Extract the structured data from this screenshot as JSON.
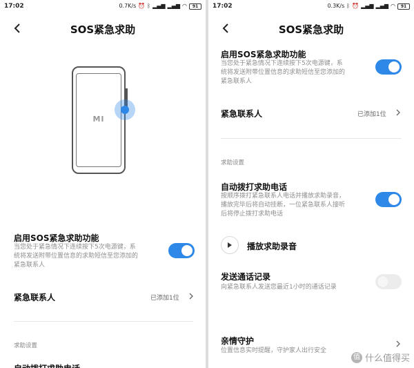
{
  "left": {
    "status": {
      "time": "17:02",
      "speed": "0.7K/s",
      "battery": "91"
    },
    "title": "SOS紧急求助",
    "illustration_logo": "MI",
    "enable": {
      "title": "启用SOS紧急求助功能",
      "desc_lines": [
        "当您处于紧急情况下连续按下5次电源键，系",
        "统将发送附带位置信息的求助短信至您添加的",
        "紧急联系人"
      ]
    },
    "contacts": {
      "title": "紧急联系人",
      "value": "已添加1位"
    },
    "section": "求助设置",
    "auto_call": {
      "title": "自动拨打求助电话"
    }
  },
  "right": {
    "status": {
      "time": "17:02",
      "speed": "0.3K/s",
      "battery": "91"
    },
    "title": "SOS紧急求助",
    "enable": {
      "title": "启用SOS紧急求助功能",
      "desc_lines": [
        "当您处于紧急情况下连续按下5次电源键，系",
        "统将发送附带位置信息的求助短信至您添加的",
        "紧急联系人"
      ]
    },
    "contacts": {
      "title": "紧急联系人",
      "value": "已添加1位"
    },
    "section": "求助设置",
    "auto_call": {
      "title": "自动拨打求助电话",
      "desc_lines": [
        "按顺序拨打紧急联系人电话并播放求助录音，",
        "播放完毕后将自动挂断，一位紧急联系人接听",
        "后将停止拨打求助电话"
      ]
    },
    "play": {
      "label": "播放求助录音"
    },
    "send_log": {
      "title": "发送通话记录",
      "desc": "向紧急联系人发送您最近1小时的通话记录"
    },
    "family": {
      "title": "亲情守护",
      "desc": "位置信息实时提醒，守护家人出行安全"
    }
  },
  "toggles": {
    "enable_left": true,
    "enable_right": true,
    "auto_call": true,
    "send_log": false
  },
  "colors": {
    "accent": "#2e88e8"
  },
  "watermark": {
    "badge": "值",
    "text": "什么值得买"
  }
}
